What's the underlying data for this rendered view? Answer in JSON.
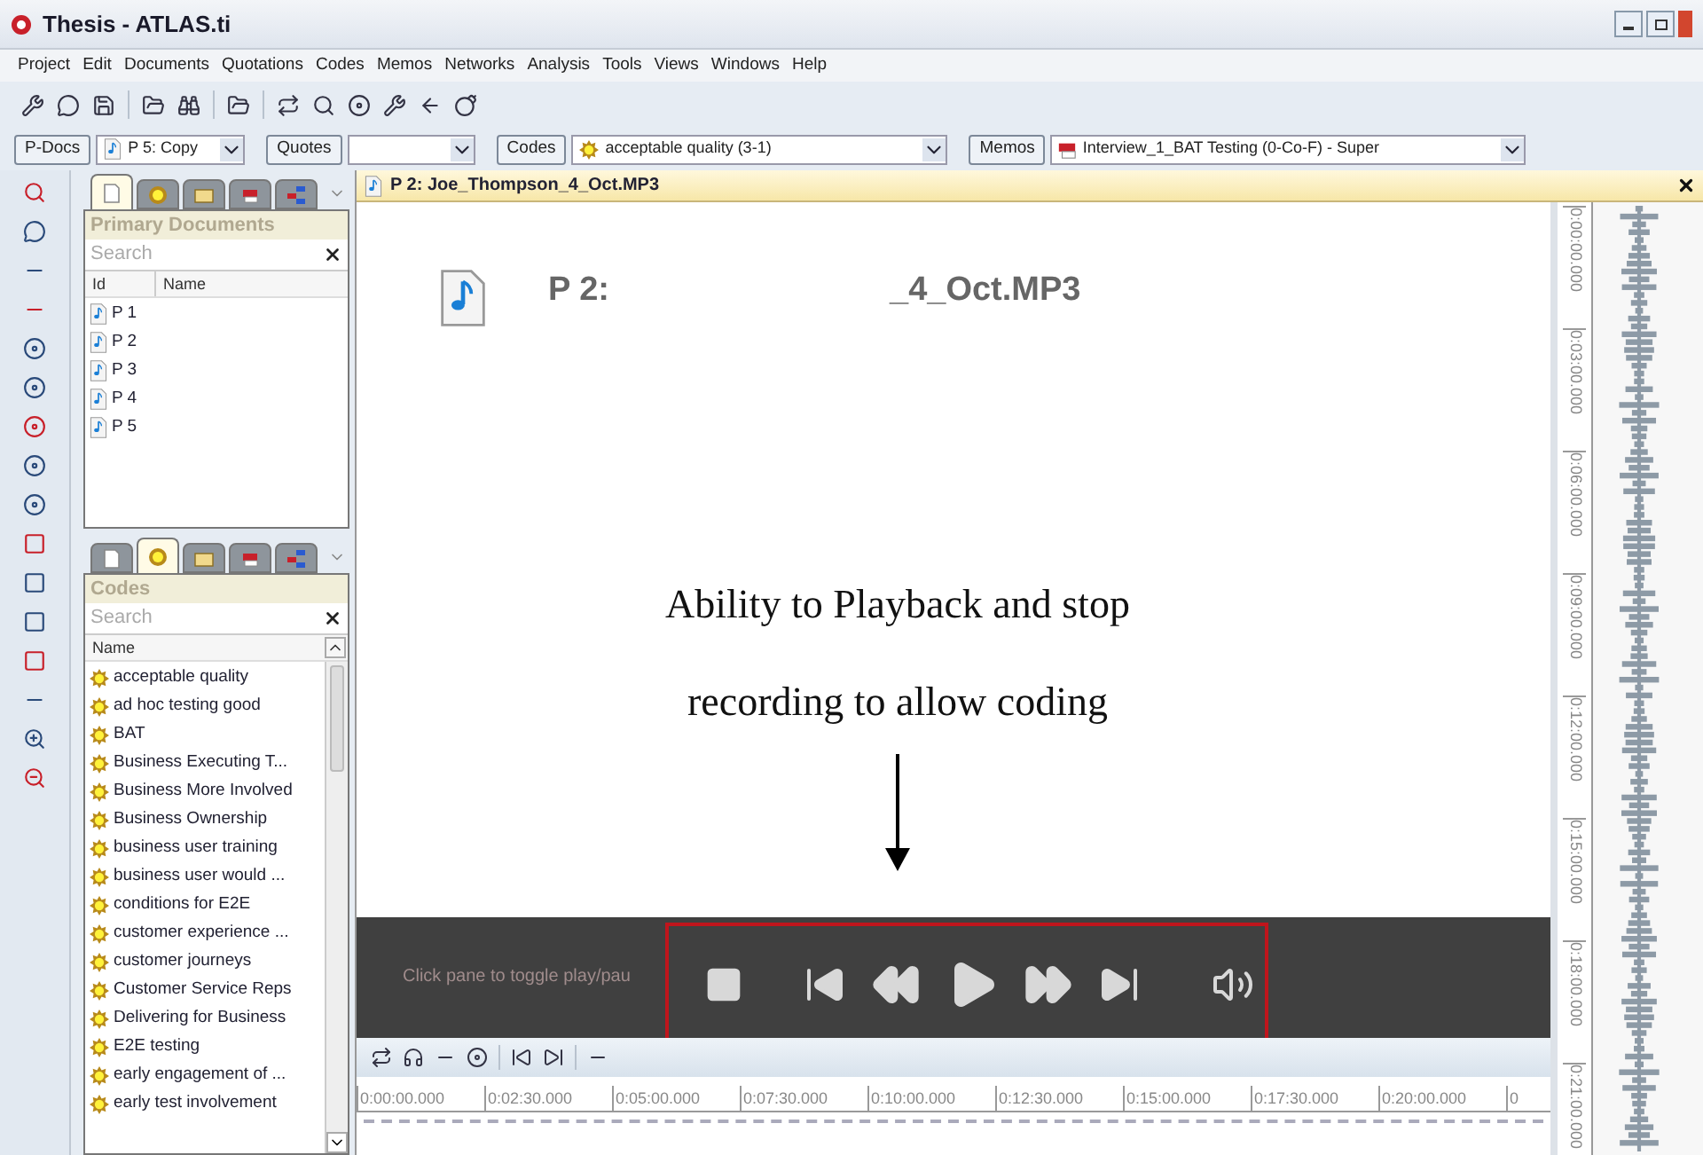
{
  "window": {
    "title": "Thesis - ATLAS.ti"
  },
  "menu": [
    "Project",
    "Edit",
    "Documents",
    "Quotations",
    "Codes",
    "Memos",
    "Networks",
    "Analysis",
    "Tools",
    "Views",
    "Windows",
    "Help"
  ],
  "selectors": [
    {
      "button": "P-Docs",
      "value": "P 5: Copy",
      "kind": "doc"
    },
    {
      "button": "Quotes",
      "kind": "plain"
    },
    {
      "button": "Codes",
      "value": "acceptable quality (3-1)",
      "kind": "code"
    },
    {
      "button": "Memos",
      "value": "Interview_1_BAT Testing (0-Co-F) - Super",
      "kind": "memo"
    }
  ],
  "navigator": [
    {
      "tabs": [
        {
          "kind": "doc",
          "selected": true
        },
        {
          "kind": "code",
          "selected": false
        },
        {
          "kind": "folder",
          "selected": false
        },
        {
          "kind": "memo",
          "selected": false
        },
        {
          "kind": "network",
          "selected": false
        }
      ],
      "title": "Primary Documents",
      "search": {
        "placeholder": "Search"
      },
      "columns": [
        "Id",
        "Name"
      ],
      "items": [
        {
          "label": "P 1",
          "kind": "doc"
        },
        {
          "label": "P 2",
          "kind": "doc"
        },
        {
          "label": "P 3",
          "kind": "doc"
        },
        {
          "label": "P 4",
          "kind": "doc"
        },
        {
          "label": "P 5",
          "kind": "doc"
        }
      ]
    },
    {
      "tabs": [
        {
          "kind": "doc",
          "selected": false
        },
        {
          "kind": "code",
          "selected": true
        },
        {
          "kind": "folder",
          "selected": false
        },
        {
          "kind": "memo",
          "selected": false
        },
        {
          "kind": "network",
          "selected": false
        }
      ],
      "title": "Codes",
      "search": {
        "placeholder": "Search"
      },
      "columns": [
        "Name"
      ],
      "items": [
        {
          "label": "acceptable quality",
          "kind": "code"
        },
        {
          "label": "ad hoc testing good",
          "kind": "code"
        },
        {
          "label": "BAT",
          "kind": "code"
        },
        {
          "label": "Business Executing T...",
          "kind": "code"
        },
        {
          "label": "Business More Involved",
          "kind": "code"
        },
        {
          "label": "Business Ownership",
          "kind": "code"
        },
        {
          "label": "business user training",
          "kind": "code"
        },
        {
          "label": "business user would ...",
          "kind": "code"
        },
        {
          "label": "conditions for E2E",
          "kind": "code"
        },
        {
          "label": "customer experience ...",
          "kind": "code"
        },
        {
          "label": "customer journeys",
          "kind": "code"
        },
        {
          "label": "Customer Service Reps",
          "kind": "code"
        },
        {
          "label": "Delivering for Business",
          "kind": "code"
        },
        {
          "label": "E2E testing",
          "kind": "code"
        },
        {
          "label": "early engagement of ...",
          "kind": "code"
        },
        {
          "label": "early test involvement",
          "kind": "code"
        }
      ]
    }
  ],
  "document": {
    "tab_title": "P 2: Joe_Thompson_4_Oct.MP3",
    "heading": [
      "P 2:",
      "_4_Oct.MP3"
    ],
    "annotation": [
      "Ability to Playback and stop",
      "recording to allow coding"
    ],
    "player": {
      "hint": "Click pane to toggle play/pau"
    },
    "timeline": [
      "0:00:00.000",
      "0:02:30.000",
      "0:05:00.000",
      "0:07:30.000",
      "0:10:00.000",
      "0:12:30.000",
      "0:15:00.000",
      "0:17:30.000",
      "0:20:00.000",
      "0"
    ],
    "vertical_ruler": [
      "0:00:00.000",
      "0:03:00.000",
      "0:06:00.000",
      "0:09:00.000",
      "0:12:00.000",
      "0:15:00.000",
      "0:18:00.000",
      "0:21:00.000"
    ]
  }
}
